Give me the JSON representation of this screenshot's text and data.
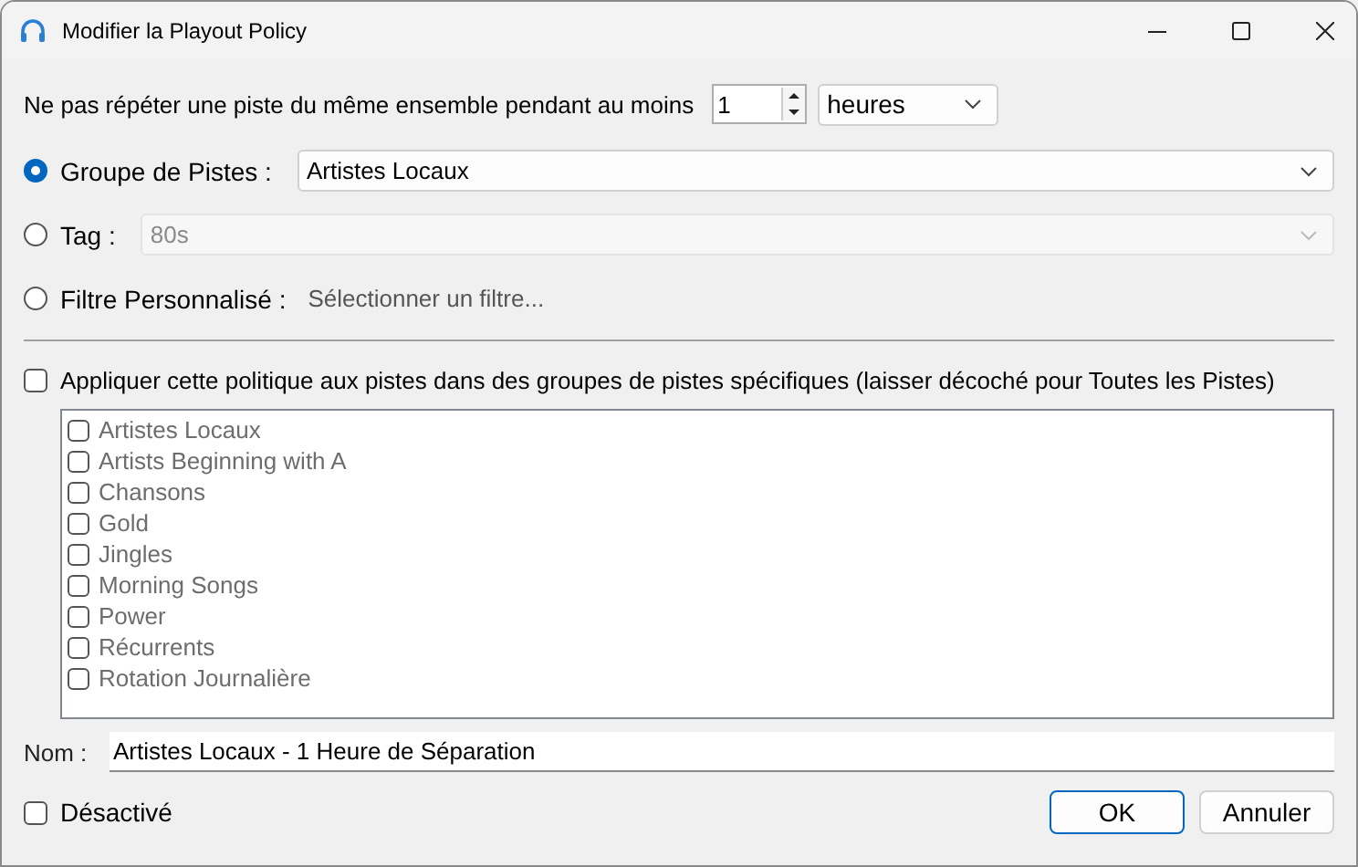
{
  "window": {
    "title": "Modifier la Playout Policy"
  },
  "repeat": {
    "label": "Ne pas répéter une piste du même ensemble pendant au moins",
    "value": "1",
    "unit": "heures"
  },
  "sources": [
    {
      "kind": "combo",
      "label": "Groupe de Pistes :",
      "value": "Artistes Locaux",
      "selected": true,
      "disabled": false
    },
    {
      "kind": "combo",
      "label": "Tag :",
      "value": "80s",
      "selected": false,
      "disabled": true
    },
    {
      "kind": "link",
      "label": "Filtre Personnalisé :",
      "value": "Sélectionner un filtre...",
      "selected": false
    }
  ],
  "apply": {
    "label": "Appliquer cette politique aux pistes dans des groupes de pistes spécifiques (laisser décoché pour Toutes les Pistes)",
    "checked": false
  },
  "group_list": {
    "disabled": true,
    "items": [
      {
        "label": "Artistes Locaux",
        "checked": false
      },
      {
        "label": "Artists Beginning with A",
        "checked": false
      },
      {
        "label": "Chansons",
        "checked": false
      },
      {
        "label": "Gold",
        "checked": false
      },
      {
        "label": "Jingles",
        "checked": false
      },
      {
        "label": "Morning Songs",
        "checked": false
      },
      {
        "label": "Power",
        "checked": false
      },
      {
        "label": "Récurrents",
        "checked": false
      },
      {
        "label": "Rotation Journalière",
        "checked": false
      }
    ]
  },
  "name": {
    "label": "Nom :",
    "value": "Artistes Locaux - 1 Heure de Séparation"
  },
  "deactivated": {
    "label": "Désactivé",
    "checked": false
  },
  "buttons": [
    {
      "label": "OK",
      "default": true
    },
    {
      "label": "Annuler",
      "default": false
    }
  ]
}
